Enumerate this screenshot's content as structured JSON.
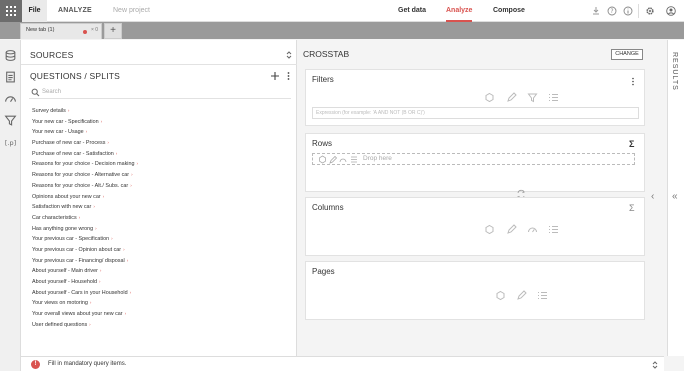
{
  "topbar": {
    "file_label": "File",
    "analyze_label": "ANALYZE",
    "project_name": "New project",
    "nav": [
      "Get data",
      "Analyze",
      "Compose"
    ]
  },
  "tabs": {
    "current_tab": "New tab (1)",
    "close_glyph": "× 0"
  },
  "sources": {
    "title": "SOURCES"
  },
  "questions": {
    "title": "QUESTIONS / SPLITS",
    "search_placeholder": "Search",
    "items": [
      "Survey details",
      "Your new car - Specification",
      "Your new car - Usage",
      "Purchase of new car - Process",
      "Purchase of new car - Satisfaction",
      "Reasons for your choice - Decision making",
      "Reasons for your choice - Alternative car",
      "Reasons for your choice - Alt./ Subs. car",
      "Opinions about your new car",
      "Satisfaction with new car",
      "Car characteristics",
      "Has anything gone wrong",
      "Your previous car - Specification",
      "Your previous car - Opinion about car",
      "Your previous car - Financing/ disposal",
      "About yourself - Main driver",
      "About yourself - Household",
      "About yourself - Cars in your Household",
      "Your views on motoring",
      "Your overall views about your new car",
      "User defined questions"
    ],
    "item_marker": "›"
  },
  "crosstab": {
    "title": "CROSSTAB",
    "change_label": "CHANGE",
    "filters_title": "Filters",
    "filter_placeholder": "Expression (for example: 'A AND NOT (B OR C)')",
    "rows_title": "Rows",
    "drop_here": "Drop here",
    "columns_title": "Columns",
    "pages_title": "Pages",
    "sigma": "Σ"
  },
  "results": {
    "label": "RESULTS"
  },
  "status": {
    "message": "Fill in mandatory query items."
  },
  "colors": {
    "accent": "#d9534f",
    "rail": "#6d6d6d"
  }
}
